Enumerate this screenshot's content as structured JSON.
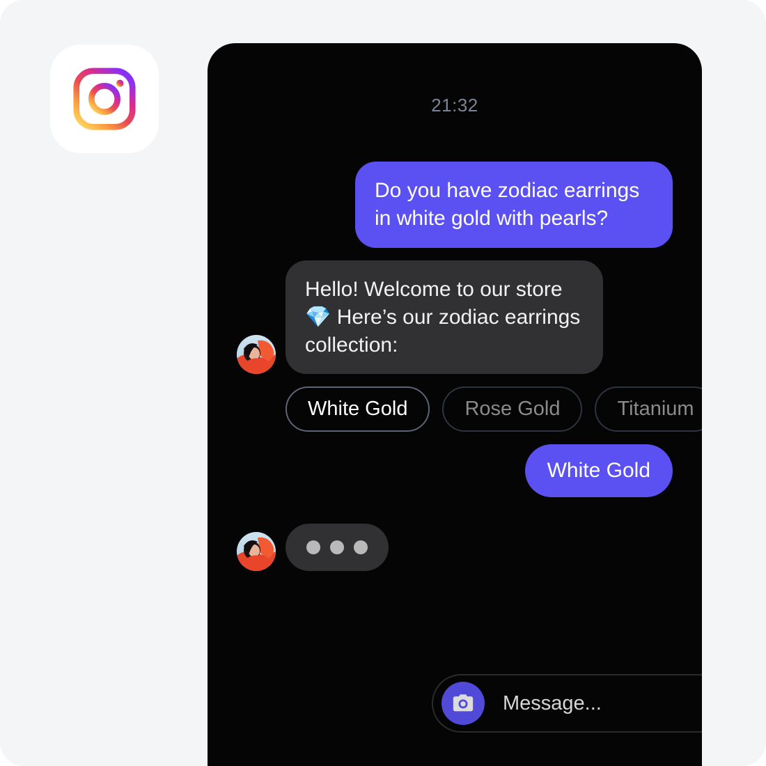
{
  "app": {
    "icon_name": "instagram-icon",
    "brand_gradient": [
      "#7638FA",
      "#D92E7F",
      "#F9A03F"
    ]
  },
  "chat": {
    "time": "21:32",
    "bubble_out_color": "#5B51F2",
    "bubble_in_color": "#313134",
    "messages": [
      {
        "id": "m1",
        "side": "out",
        "text": "Do you have zodiac earrings in white gold with pearls?"
      },
      {
        "id": "m2",
        "side": "in",
        "emoji": "💎",
        "text_before": "Hello! Welcome to our store ",
        "text_after": " Here’s our zodiac earrings collection:"
      },
      {
        "id": "m3",
        "side": "out",
        "text": "White Gold"
      }
    ],
    "quick_replies": [
      {
        "label": "White Gold",
        "selected": true
      },
      {
        "label": "Rose Gold",
        "selected": false
      },
      {
        "label": "Titanium",
        "selected": false
      }
    ],
    "typing_indicator": {
      "name": "typing-indicator",
      "dots": 3
    },
    "avatar_name": "agent-avatar"
  },
  "composer": {
    "camera_button_name": "camera-button",
    "placeholder": "Message...",
    "mic_icon": "microphone-icon",
    "photo_icon": "photo-icon"
  }
}
